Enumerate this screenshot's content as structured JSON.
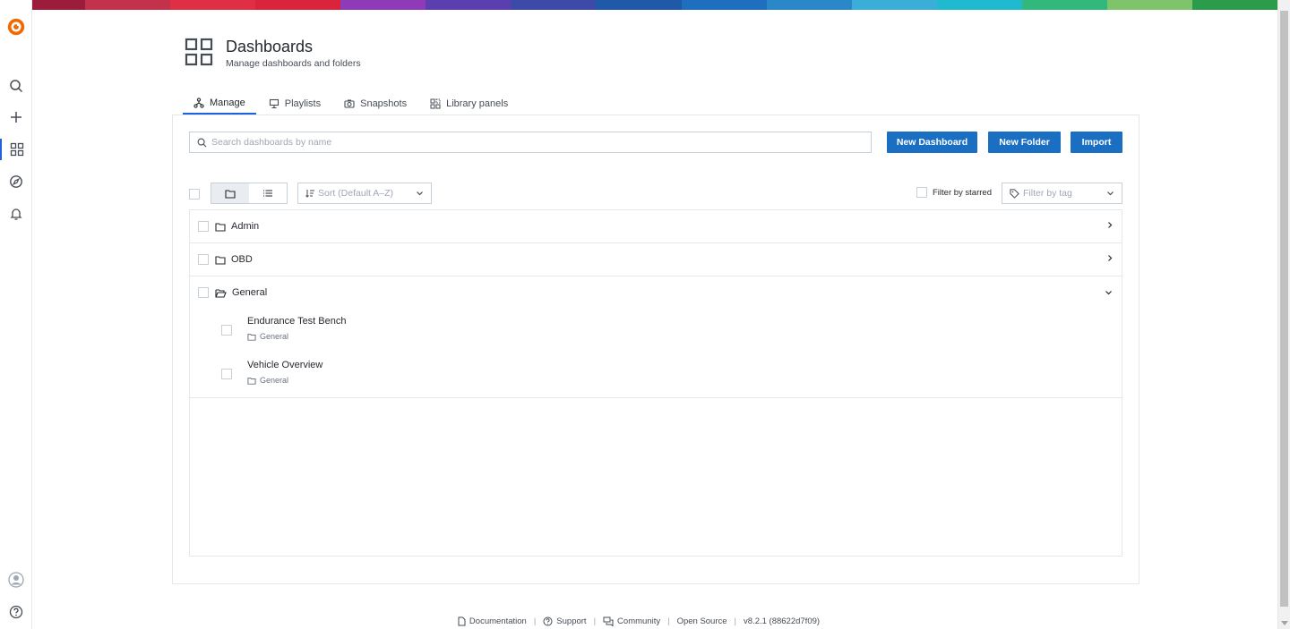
{
  "header": {
    "title": "Dashboards",
    "subtitle": "Manage dashboards and folders"
  },
  "tabs": [
    {
      "label": "Manage",
      "icon": "sitemap-icon",
      "active": true
    },
    {
      "label": "Playlists",
      "icon": "presentation-icon",
      "active": false
    },
    {
      "label": "Snapshots",
      "icon": "camera-icon",
      "active": false
    },
    {
      "label": "Library panels",
      "icon": "library-panels-icon",
      "active": false
    }
  ],
  "search": {
    "placeholder": "Search dashboards by name"
  },
  "buttons": {
    "new_dashboard": "New Dashboard",
    "new_folder": "New Folder",
    "import": "Import"
  },
  "controls": {
    "sort_label": "Sort (Default A–Z)",
    "starred_label": "Filter by starred",
    "tag_placeholder": "Filter by tag"
  },
  "folders": [
    {
      "name": "Admin",
      "expanded": false
    },
    {
      "name": "OBD",
      "expanded": false
    },
    {
      "name": "General",
      "expanded": true
    }
  ],
  "dashboards": [
    {
      "title": "Endurance Test Bench",
      "folder": "General"
    },
    {
      "title": "Vehicle Overview",
      "folder": "General"
    }
  ],
  "footer": {
    "documentation": "Documentation",
    "support": "Support",
    "community": "Community",
    "open_source": "Open Source",
    "version": "v8.2.1 (88622d7f09)",
    "separator": "|"
  },
  "colors": {
    "accent": "#1f62e0",
    "button": "#1a6fc2",
    "topbar": [
      "#9b1d3b",
      "#c4314b",
      "#e02f44",
      "#d9243c",
      "#8f3bb8",
      "#5b3fb0",
      "#3e4aa8",
      "#1f5aa8",
      "#1f6fc0",
      "#2a88c8",
      "#3aaed8",
      "#1fbad0",
      "#33b87c",
      "#7ec46a",
      "#2b9b4c"
    ]
  }
}
